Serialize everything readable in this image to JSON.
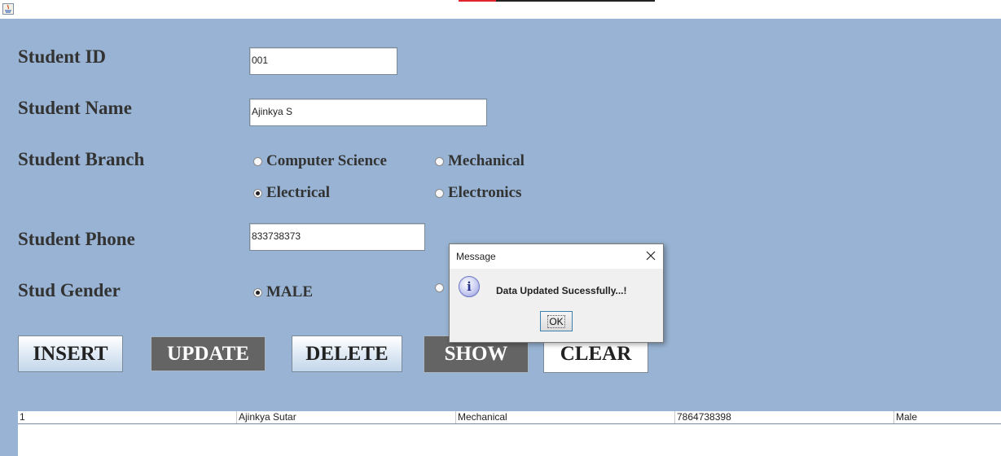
{
  "form": {
    "id_label": "Student ID",
    "id_value": "001",
    "name_label": "Student Name",
    "name_value": "Ajinkya S",
    "branch_label": "Student Branch",
    "branch_options": [
      "Computer Science",
      "Mechanical",
      "Electrical",
      "Electronics"
    ],
    "branch_selected": "Electrical",
    "phone_label": "Student Phone",
    "phone_value": "833738373",
    "gender_label": "Stud Gender",
    "gender_option_male": "MALE",
    "gender_selected": "MALE"
  },
  "buttons": {
    "insert": "INSERT",
    "update": "UPDATE",
    "delete": "DELETE",
    "show": "SHOW",
    "clear": "CLEAR"
  },
  "table": {
    "rows": [
      [
        "1",
        "Ajinkya Sutar",
        "Mechanical",
        "7864738398",
        "Male"
      ]
    ]
  },
  "dialog": {
    "title": "Message",
    "message": "Data Updated Sucessfully...!",
    "ok_label": "OK",
    "icon": "info-icon"
  },
  "colors": {
    "panel_background": "#98b3d3",
    "dark_button": "#646464"
  }
}
